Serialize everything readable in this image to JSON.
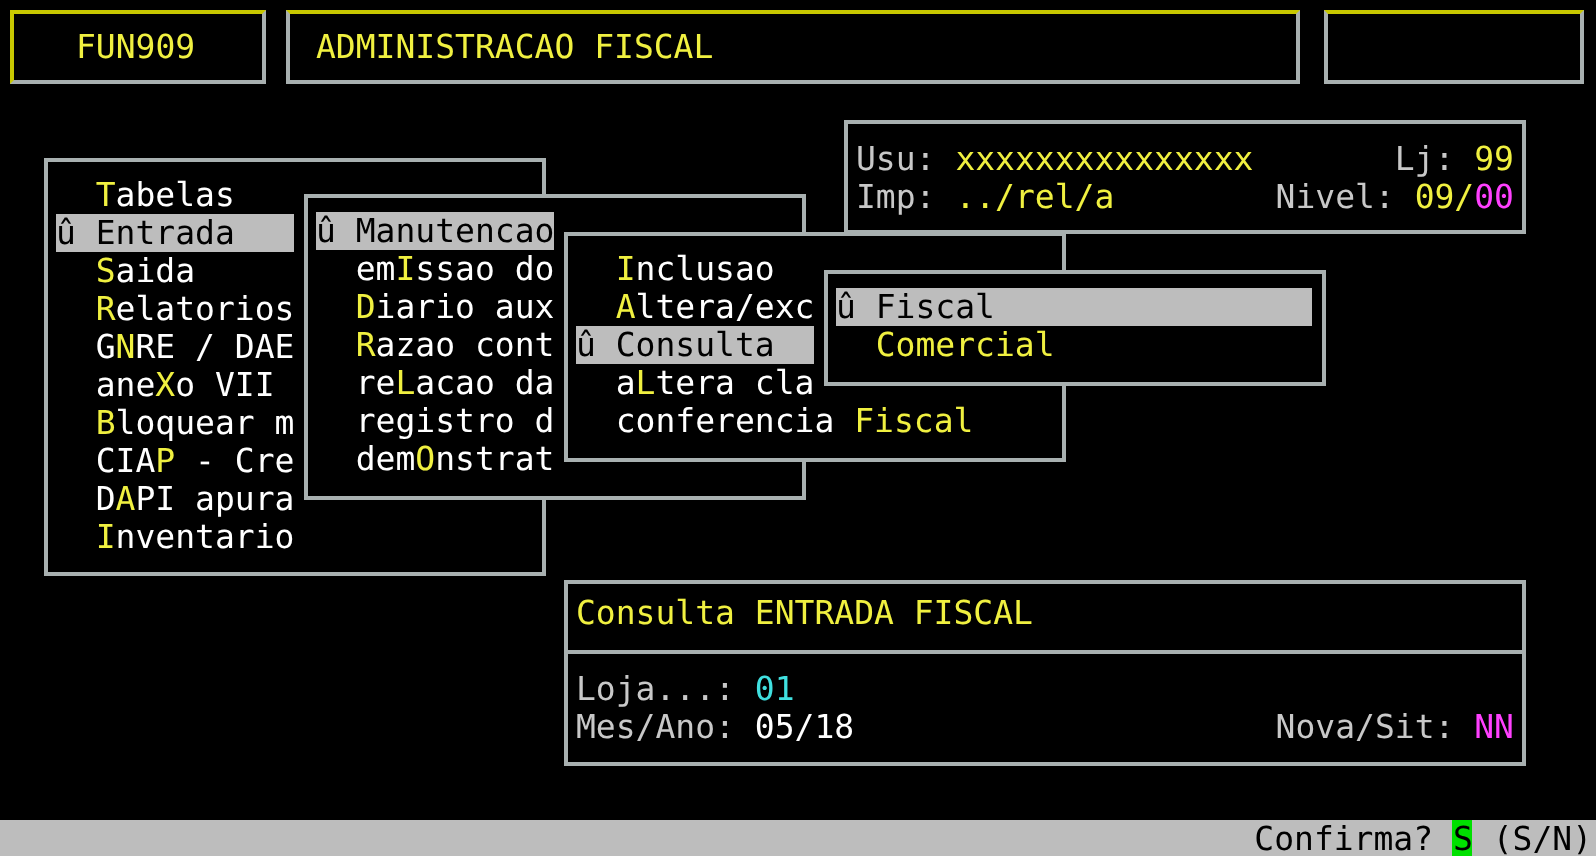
{
  "header": {
    "program_code": "FUN909",
    "title": "ADMINISTRACAO FISCAL"
  },
  "session": {
    "rows": [
      {
        "fields": [
          {
            "label": "Usu:",
            "value_parts": [
              {
                "text": "xxxxxxxxxxxxxxx",
                "kind": "normal"
              }
            ]
          },
          {
            "label": "Lj:",
            "value_parts": [
              {
                "text": "99",
                "kind": "normal"
              }
            ]
          }
        ]
      },
      {
        "fields": [
          {
            "label": "Imp:",
            "value_parts": [
              {
                "text": "../rel/a",
                "kind": "normal"
              }
            ]
          },
          {
            "label": "Nivel:",
            "value_parts": [
              {
                "text": "09/",
                "kind": "normal"
              },
              {
                "text": "00",
                "kind": "alert"
              }
            ]
          }
        ]
      }
    ]
  },
  "menus": [
    {
      "items": [
        {
          "selected": false,
          "key": "T",
          "post": "abelas"
        },
        {
          "selected": true,
          "marker": "û",
          "post": "Entrada"
        },
        {
          "selected": false,
          "key": "S",
          "post": "aida"
        },
        {
          "selected": false,
          "key": "R",
          "post": "elatorios"
        },
        {
          "selected": false,
          "pre": "G",
          "key": "N",
          "post": "RE / DAE"
        },
        {
          "selected": false,
          "pre": "ane",
          "key": "X",
          "post": "o VII"
        },
        {
          "selected": false,
          "key": "B",
          "post": "loquear m"
        },
        {
          "selected": false,
          "pre": "CIA",
          "key": "P",
          "post": " - Cre"
        },
        {
          "selected": false,
          "pre": "D",
          "key": "A",
          "post": "PI apura"
        },
        {
          "selected": false,
          "key": "I",
          "post": "nventario"
        }
      ]
    },
    {
      "items": [
        {
          "selected": true,
          "marker": "û",
          "post": "Manutencao"
        },
        {
          "selected": false,
          "pre": "em",
          "key": "I",
          "post": "ssao do"
        },
        {
          "selected": false,
          "key": "D",
          "post": "iario aux"
        },
        {
          "selected": false,
          "key": "R",
          "post": "azao cont"
        },
        {
          "selected": false,
          "pre": "re",
          "key": "L",
          "post": "acao da"
        },
        {
          "selected": false,
          "pre": "registro d"
        },
        {
          "selected": false,
          "pre": "dem",
          "key": "O",
          "post": "nstrat"
        }
      ]
    },
    {
      "items": [
        {
          "selected": false,
          "key": "I",
          "post": "nclusao"
        },
        {
          "selected": false,
          "key": "A",
          "post": "ltera/exc"
        },
        {
          "selected": true,
          "marker": "û",
          "post": "Consulta"
        },
        {
          "selected": false,
          "pre": "a",
          "key": "L",
          "post": "tera cla"
        },
        {
          "selected": false,
          "pre": "conferencia ",
          "key": "Fiscal"
        }
      ]
    },
    {
      "items": [
        {
          "selected": true,
          "marker": "û",
          "post": "Fiscal"
        },
        {
          "selected": false,
          "key": "Comercial"
        }
      ]
    }
  ],
  "dialog": {
    "title": "Consulta ENTRADA FISCAL",
    "fields": [
      {
        "label": "Loja...:",
        "value": "01",
        "kind": "active"
      },
      {
        "label": "Mes/Ano:",
        "value": "05/18",
        "kind": "plain"
      },
      {
        "label": "Nova/Sit:",
        "value": "NN",
        "kind": "flag"
      }
    ]
  },
  "status_bar": {
    "prompt": "Confirma?",
    "answer": "S",
    "options": "(S/N)"
  }
}
